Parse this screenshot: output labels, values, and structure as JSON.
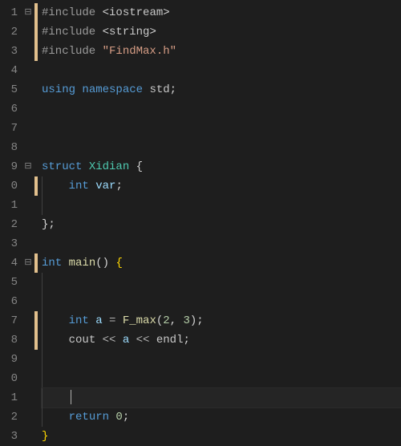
{
  "editor": {
    "visible_lines": 23,
    "cursor_line": 21,
    "line_numbers": [
      "1",
      "2",
      "3",
      "4",
      "5",
      "6",
      "7",
      "8",
      "9",
      "0",
      "1",
      "2",
      "3",
      "4",
      "5",
      "6",
      "7",
      "8",
      "9",
      "0",
      "1",
      "2",
      "3"
    ],
    "fold_markers": {
      "1": "⊟",
      "9": "⊟",
      "14": "⊟"
    },
    "diff_markers": [
      1,
      2,
      3,
      10,
      14,
      17,
      18
    ],
    "code": {
      "l1": {
        "pp": "#include ",
        "ang_open": "<",
        "lib": "iostream",
        "ang_close": ">"
      },
      "l2": {
        "pp": "#include ",
        "ang_open": "<",
        "lib": "string",
        "ang_close": ">"
      },
      "l3": {
        "pp": "#include ",
        "str": "\"FindMax.h\""
      },
      "l5": {
        "kw1": "using ",
        "kw2": "namespace ",
        "id": "std",
        "semi": ";"
      },
      "l9": {
        "kw": "struct ",
        "ty": "Xidian ",
        "brace": "{"
      },
      "l10": {
        "kw": "int ",
        "var": "var",
        "semi": ";"
      },
      "l12": {
        "brace": "}",
        "semi": ";"
      },
      "l14": {
        "kw": "int ",
        "fn": "main",
        "paren": "() ",
        "brace": "{"
      },
      "l17": {
        "kw": "int ",
        "var": "a ",
        "op": "= ",
        "fn": "F_max",
        "args_open": "(",
        "n1": "2",
        "comma": ", ",
        "n2": "3",
        "args_close": ")",
        "semi": ";"
      },
      "l18": {
        "obj1": "cout ",
        "op1": "<< ",
        "var": "a ",
        "op2": "<< ",
        "obj2": "endl",
        "semi": ";"
      },
      "l22": {
        "kw": "return ",
        "n": "0",
        "semi": ";"
      },
      "l23": {
        "brace": "}"
      }
    }
  }
}
